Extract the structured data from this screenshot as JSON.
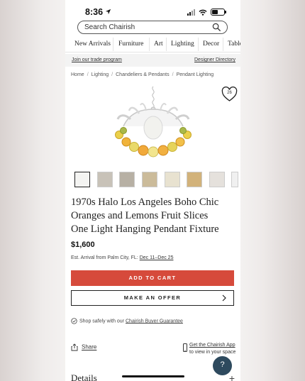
{
  "status_bar": {
    "time": "8:36"
  },
  "search": {
    "placeholder": "Search Chairish"
  },
  "nav": {
    "items": [
      "New Arrivals",
      "Furniture",
      "Art",
      "Lighting",
      "Decor",
      "Table"
    ]
  },
  "trade_bar": {
    "left_link": "Join our trade program",
    "right_link": "Designer Directory"
  },
  "breadcrumb": [
    "Home",
    "Lighting",
    "Chandeliers & Pendants",
    "Pendant Lighting"
  ],
  "favorite": {
    "count": "26"
  },
  "product": {
    "title_lines": [
      "1970s Halo Los Angeles Boho Chic",
      "Oranges and Lemons Fruit Slices",
      "One Light Hanging Pendant Fixture"
    ],
    "price": "$1,600",
    "arrival_prefix": "Est. Arrival from Palm City, FL:",
    "arrival_dates": "Dec 11–Dec 25"
  },
  "actions": {
    "add_to_cart": "ADD TO CART",
    "make_offer": "MAKE AN OFFER"
  },
  "guarantee": {
    "prefix": "Shop safely with our",
    "link": "Chairish Buyer Guarantee"
  },
  "share": {
    "label": "Share"
  },
  "app": {
    "line1": "Get the Chairish App",
    "line2": "to view in your space"
  },
  "details": {
    "heading": "Details",
    "toggle": "+"
  },
  "help": {
    "label": "?"
  },
  "colors": {
    "cart": "#d64a3b",
    "help": "#2e4a5e"
  }
}
